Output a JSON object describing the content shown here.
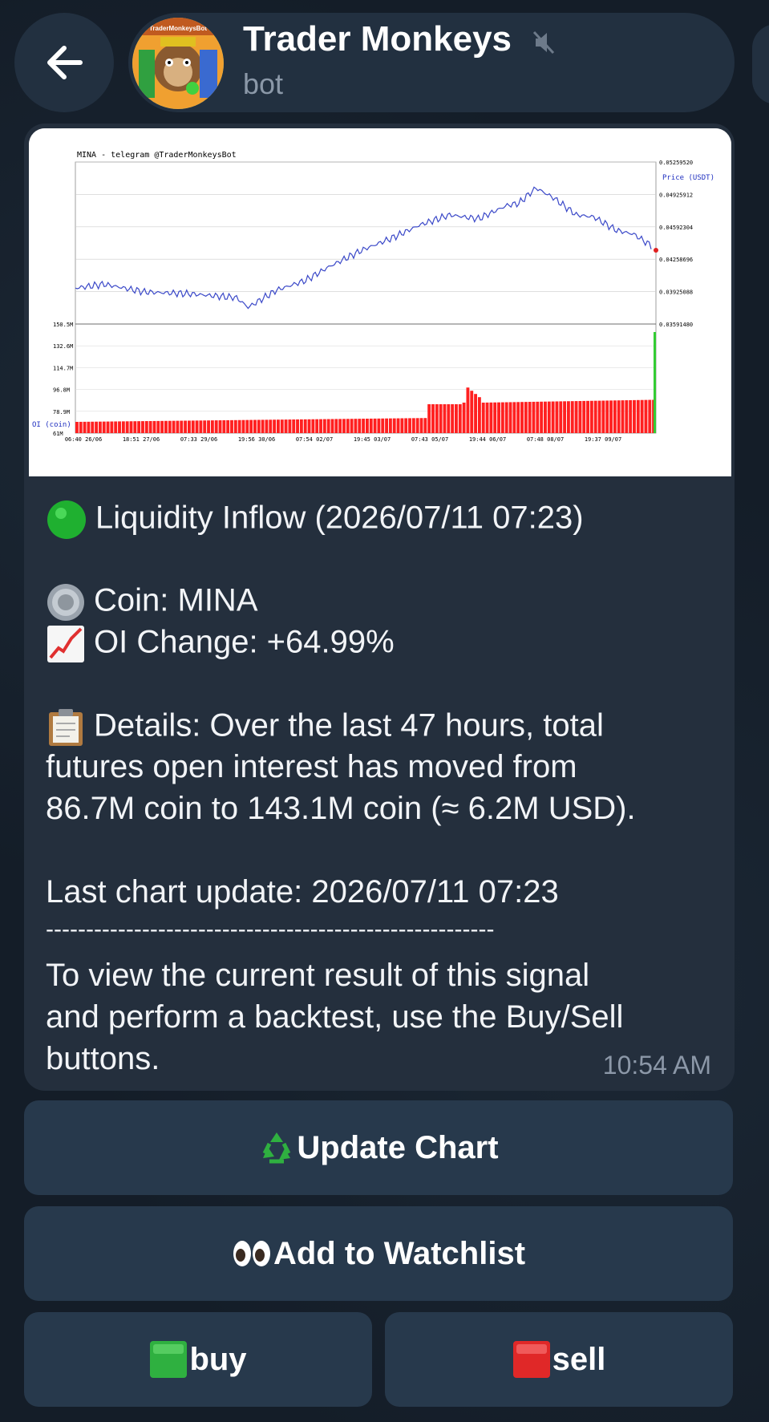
{
  "header": {
    "title": "Trader Monkeys",
    "subtitle": "bot",
    "avatar_text": "TraderMonkeysBot"
  },
  "chart_data": {
    "type": "line",
    "title": "MINA - telegram @TraderMonkeysBot",
    "ylabel": "Price (USDT)",
    "y_ticks": [
      "0.05259520",
      "0.04925912",
      "0.04592304",
      "0.04258696",
      "0.03925088",
      "0.03591480"
    ],
    "x_ticks": [
      "06:40 26/06",
      "18:51 27/06",
      "07:33 29/06",
      "19:56 30/06",
      "07:54 02/07",
      "19:45 03/07",
      "07:43 05/07",
      "19:44 06/07",
      "07:48 08/07",
      "19:37 09/07"
    ],
    "oi_label": "OI (coin)",
    "oi_ticks": [
      "150.5M",
      "132.6M",
      "114.7M",
      "96.8M",
      "78.9M",
      "61M"
    ]
  },
  "message": {
    "line1": "Liquidity Inflow (2026/07/11 07:23)",
    "line2": "Coin: MINA",
    "line3": "OI Change: +64.99%",
    "line4": "Details: Over the last 47 hours, total",
    "line5": "futures open interest has moved from",
    "line6": "86.7M coin to 143.1M coin (≈ 6.2M USD).",
    "line7": "Last chart update: 2026/07/11 07:23",
    "divider": "--------------------------------------------------------",
    "line8": "To view the current result of this signal",
    "line9": "and perform a backtest, use the Buy/Sell",
    "line10": "buttons.",
    "time": "10:54 AM"
  },
  "buttons": {
    "update": "Update Chart",
    "watchlist": "Add to Watchlist",
    "buy": "buy",
    "sell": "sell"
  },
  "colors": {
    "price_line": "#3a48c8",
    "oi_bars": "#ff2020",
    "oi_spike": "#33cc33"
  }
}
